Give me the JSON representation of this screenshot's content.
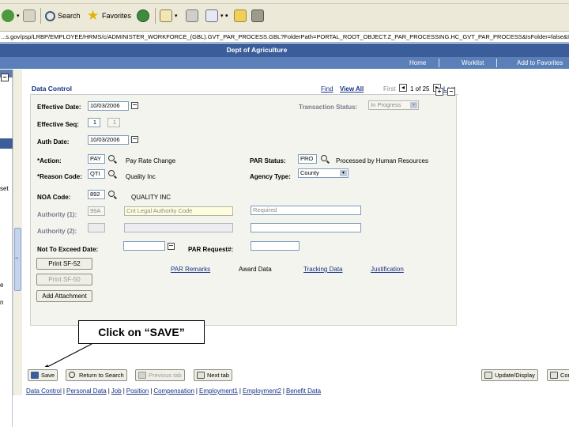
{
  "browser": {
    "toolbar": {
      "search_label": "Search",
      "favorites_label": "Favorites"
    },
    "address": "...s.gov/psp/LRBP/EMPLOYEE/HRMS/c/ADMINISTER_WORKFORCE_(GBL).GVT_PAR_PROCESS.GBL?FolderPath=PORTAL_ROOT_OBJECT.Z_PAR_PROCESSING.HC_GVT_PAR_PROCESS&IsFolder=false&IgnoreParamTempl"
  },
  "portal": {
    "dept_title": "Dept of Agriculture",
    "nav": [
      "Home",
      "Worklist",
      "Add to Favorites"
    ]
  },
  "left_frame": {
    "text_a": "set",
    "text_b": "e",
    "text_c": "n"
  },
  "form": {
    "header_title": "Data Control",
    "find": "Find",
    "view_all": "View All",
    "first": "First",
    "pager": "1 of 25",
    "last": "Last",
    "effective_date": {
      "label": "Effective Date:",
      "value": "10/03/2006"
    },
    "transaction_status": {
      "label": "Transaction Status:",
      "value": "In Progress"
    },
    "effective_seq": {
      "label": "Effective Seq:",
      "value": "1",
      "value2": "1"
    },
    "auth_date": {
      "label": "Auth Date:",
      "value": "10/03/2006"
    },
    "action": {
      "label": "*Action:",
      "value": "PAY",
      "desc": "Pay Rate Change"
    },
    "par_status": {
      "label": "PAR Status:",
      "value": "PRO",
      "desc": "Processed by Human Resources"
    },
    "reason_code": {
      "label": "*Reason Code:",
      "value": "QTI",
      "desc": "Quality Inc"
    },
    "agency_type": {
      "label": "Agency Type:",
      "value": "County"
    },
    "noa_code": {
      "label": "NOA Code:",
      "value": "892",
      "desc": "QUALITY INC"
    },
    "authority1": {
      "label": "Authority (1):",
      "value": "99A",
      "desc": "Cnt Legal Authority Code",
      "extra": "Required"
    },
    "authority2": {
      "label": "Authority (2):"
    },
    "nte_date": {
      "label": "Not To Exceed Date:"
    },
    "par_request": {
      "label": "PAR Request#:"
    },
    "print_sf52": "Print SF-52",
    "print_sf50": "Print SF-50",
    "add_attachment": "Add Attachment",
    "links": {
      "par_remarks": "PAR Remarks",
      "award_data": "Award Data",
      "tracking_data": "Tracking Data",
      "justification": "Justification"
    }
  },
  "callout": "Click on “SAVE”",
  "bottom_toolbar": {
    "save": "Save",
    "return_to_search": "Return to Search",
    "previous_tab": "Previous tab",
    "next_tab": "Next tab",
    "update_display": "Update/Display",
    "correct": "Corr"
  },
  "bottom_links": [
    "Data Control",
    "Personal Data",
    "Job",
    "Position",
    "Compensation",
    "Employment1",
    "Employment2",
    "Benefit Data"
  ],
  "colors": {
    "portal_dark": "#3b5e9a",
    "portal_light": "#5b7fb8",
    "link": "#17338a"
  }
}
